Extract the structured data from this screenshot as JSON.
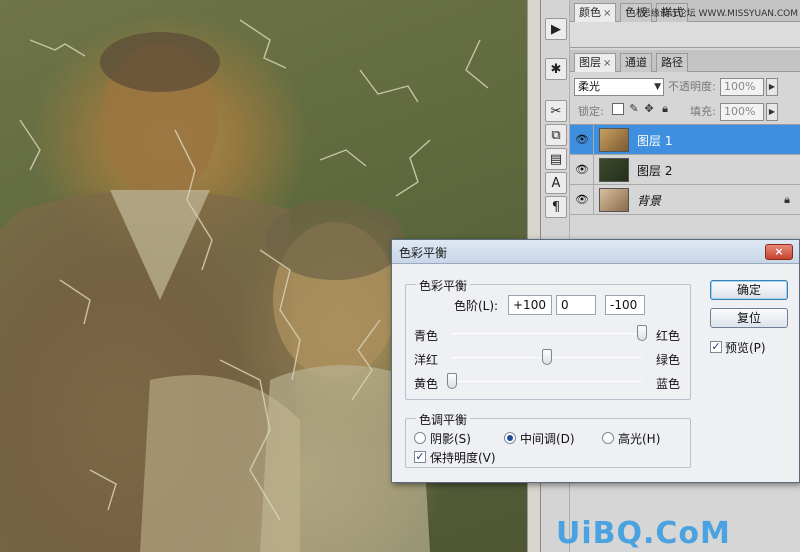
{
  "colors": {
    "selected_layer": "#3e8fe0",
    "dialog_bg": "#eef0f4",
    "close_button": "#c8432e",
    "watermark": "#4aa3e0"
  },
  "watermark": "UiBQ.CoM",
  "panel": {
    "top_tabs": [
      {
        "label": "颜色",
        "close": "×",
        "active": true
      },
      {
        "label": "色板",
        "active": false
      },
      {
        "label": "样式",
        "active": false
      }
    ],
    "credit": "思缘设计论坛 WWW.MISSYUAN.COM",
    "layer_tabs": [
      {
        "label": "图层",
        "close": "×",
        "active": true
      },
      {
        "label": "通道",
        "active": false
      },
      {
        "label": "路径",
        "active": false
      }
    ],
    "blend_mode": "柔光",
    "opacity_label": "不透明度:",
    "opacity_value": "100%",
    "lock_label": "锁定:",
    "fill_label": "填充:",
    "fill_value": "100%",
    "layers": [
      {
        "name": "图层 1",
        "selected": true,
        "visible": true,
        "thumb": "photo-warm"
      },
      {
        "name": "图层 2",
        "selected": false,
        "visible": true,
        "thumb": "texture-green"
      },
      {
        "name": "背景",
        "selected": false,
        "visible": true,
        "locked": true,
        "thumb": "photo-people"
      }
    ]
  },
  "tools": [
    {
      "icon": "play-icon",
      "glyph": "▶"
    },
    {
      "icon": "brush-settings-icon",
      "glyph": "✱"
    },
    {
      "icon": "tools-cross-icon",
      "glyph": "✂"
    },
    {
      "icon": "clone-source-icon",
      "glyph": "⧉"
    },
    {
      "icon": "tool-preset-icon",
      "glyph": "▤"
    },
    {
      "icon": "character-icon",
      "glyph": "A"
    },
    {
      "icon": "paragraph-icon",
      "glyph": "¶"
    }
  ],
  "dialog": {
    "title": "色彩平衡",
    "close_glyph": "×",
    "color_balance_group": "色彩平衡",
    "levels_label": "色阶(L):",
    "levels": [
      "+100",
      "0",
      "-100"
    ],
    "sliders": [
      {
        "left": "青色",
        "right": "红色",
        "value": 100
      },
      {
        "left": "洋红",
        "right": "绿色",
        "value": 0
      },
      {
        "left": "黄色",
        "right": "蓝色",
        "value": -100
      }
    ],
    "tone_group": "色调平衡",
    "tones": [
      {
        "label": "阴影(S)",
        "checked": false
      },
      {
        "label": "中间调(D)",
        "checked": true
      },
      {
        "label": "高光(H)",
        "checked": false
      }
    ],
    "preserve_luminosity": "保持明度(V)",
    "preserve_checked": true,
    "ok": "确定",
    "reset": "复位",
    "preview": "预览(P)",
    "preview_checked": true,
    "check_glyph": "✓"
  }
}
